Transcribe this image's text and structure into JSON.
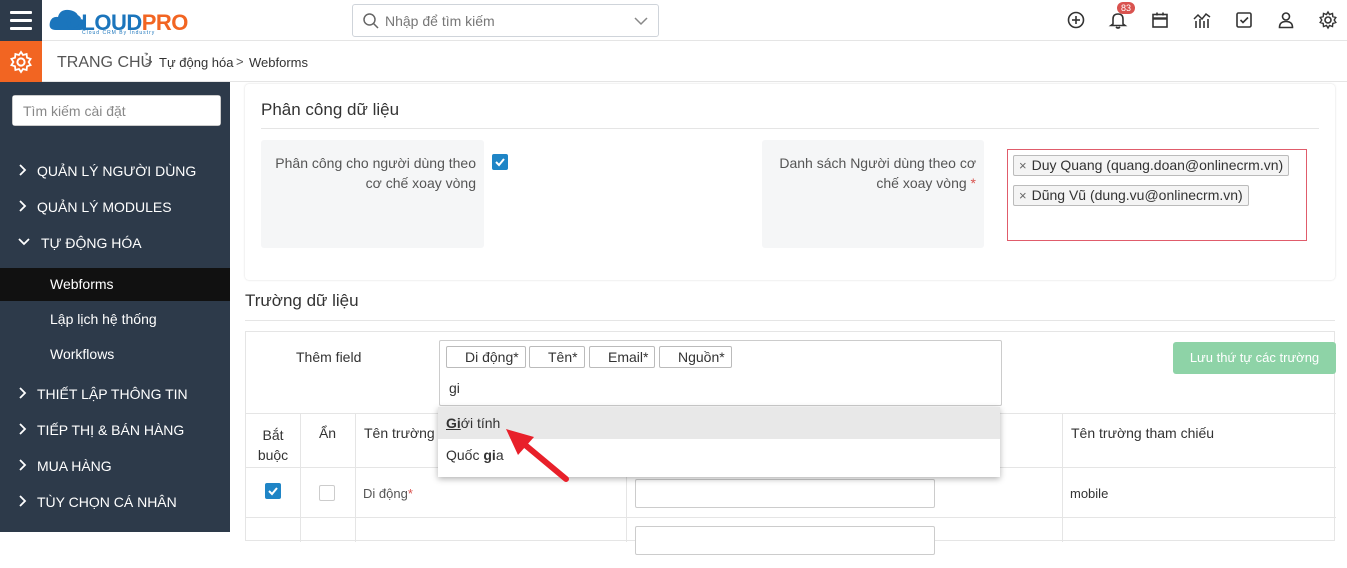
{
  "header": {
    "logo_main": "CLOUD",
    "logo_accent": "PRO",
    "logo_tagline": "Cloud CRM By Industry",
    "search_placeholder": "Nhập để tìm kiếm",
    "notification_count": "83",
    "icons": [
      "plus-circle-icon",
      "bell-icon",
      "calendar-icon",
      "chart-icon",
      "checkbox-icon",
      "user-icon",
      "gear-icon"
    ]
  },
  "breadcrumb": {
    "home": "TRANG CHỦ",
    "level2": "Tự động hóa",
    "level3": "Webforms",
    "separator": ">"
  },
  "sidebar": {
    "search_placeholder": "Tìm kiếm cài đặt",
    "items": [
      {
        "label": "QUẢN LÝ NGƯỜI DÙNG",
        "expanded": false
      },
      {
        "label": "QUẢN LÝ MODULES",
        "expanded": false
      },
      {
        "label": "TỰ ĐỘNG HÓA",
        "expanded": true
      },
      {
        "label": "THIẾT LẬP THÔNG TIN",
        "expanded": false
      },
      {
        "label": "TIẾP THỊ & BÁN HÀNG",
        "expanded": false
      },
      {
        "label": "MUA HÀNG",
        "expanded": false
      },
      {
        "label": "TÙY CHỌN CÁ NHÂN",
        "expanded": false
      }
    ],
    "subitems": [
      {
        "label": "Webforms",
        "active": true
      },
      {
        "label": "Lập lịch hệ thống",
        "active": false
      },
      {
        "label": "Workflows",
        "active": false
      }
    ]
  },
  "assignment": {
    "title": "Phân công dữ liệu",
    "round_robin_label_1": "Phân công cho người dùng theo",
    "round_robin_label_2": "cơ chế xoay vòng",
    "round_robin_checked": true,
    "user_list_label_1": "Danh sách Người dùng theo cơ",
    "user_list_label_2": "chế xoay vòng",
    "required_mark": "*",
    "users": [
      "Duy Quang (quang.doan@onlinecrm.vn)",
      "Dũng Vũ (dung.vu@onlinecrm.vn)"
    ],
    "remove_glyph": "×"
  },
  "fields": {
    "section_title": "Trường dữ liệu",
    "add_field_label": "Thêm field",
    "selected_chips": [
      "Di động*",
      "Tên*",
      "Email*",
      "Nguồn*"
    ],
    "typed_text": "gi",
    "save_order_button": "Lưu thứ tự các trường",
    "columns": {
      "required_1": "Bắt",
      "required_2": "buộc",
      "hidden": "Ẩn",
      "field_name": "Tên trường",
      "reference_name": "Tên trường tham chiếu"
    },
    "rows": [
      {
        "required": true,
        "hidden": false,
        "name": "Di động",
        "required_mark": "*",
        "reference": "mobile"
      }
    ]
  },
  "dropdown": {
    "options": [
      {
        "match": "Gi",
        "rest": "ới tính",
        "highlighted": true
      },
      {
        "prefix": "Quốc ",
        "match": "gi",
        "rest": "a",
        "highlighted": false
      }
    ]
  },
  "colors": {
    "sidebar_bg": "#2d3a4a",
    "accent_orange": "#f26522",
    "brand_blue": "#1b75bc",
    "checkbox_blue": "#1f85c6",
    "save_button_green": "#8ed3a7",
    "error_border": "#e05c6b",
    "annotation_arrow": "#e8202a"
  }
}
